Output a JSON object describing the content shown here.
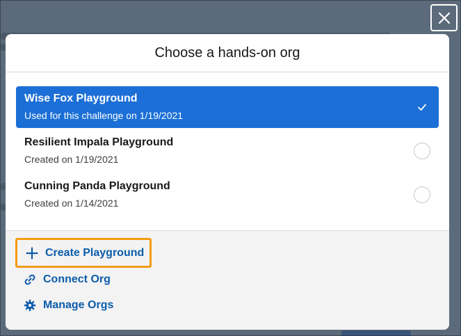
{
  "modal": {
    "title": "Choose a hands-on org",
    "close_icon": "close-icon"
  },
  "orgs": [
    {
      "name": "Wise Fox Playground",
      "subtitle": "Used for this challenge on 1/19/2021",
      "selected": true
    },
    {
      "name": "Resilient Impala Playground",
      "subtitle": "Created on 1/19/2021",
      "selected": false
    },
    {
      "name": "Cunning Panda Playground",
      "subtitle": "Created on 1/14/2021",
      "selected": false
    }
  ],
  "actions": {
    "create": {
      "label": "Create Playground",
      "icon": "plus-icon"
    },
    "connect": {
      "label": "Connect Org",
      "icon": "link-icon"
    },
    "manage": {
      "label": "Manage Orgs",
      "icon": "gear-icon"
    }
  },
  "colors": {
    "selected_bg": "#1b6fd6",
    "action_text": "#0b5cab",
    "highlight_border": "#f39c12"
  }
}
